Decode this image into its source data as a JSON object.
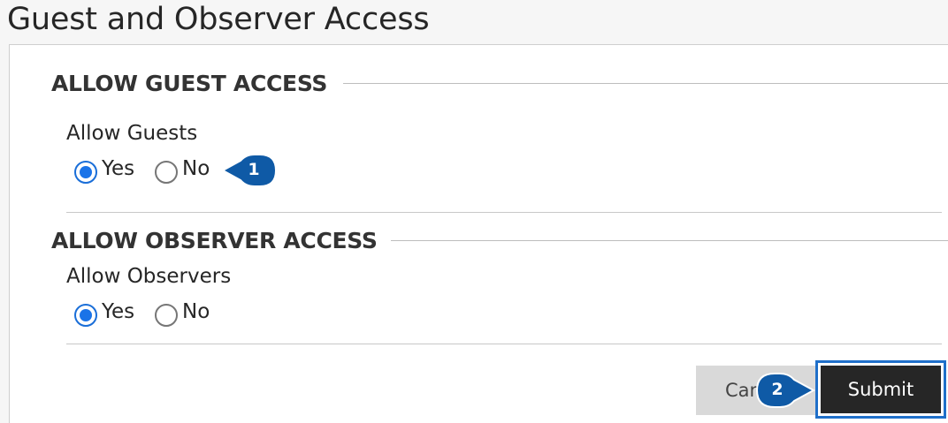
{
  "page": {
    "title": "Guest and Observer Access"
  },
  "guest_section": {
    "heading": "ALLOW GUEST ACCESS",
    "field_label": "Allow Guests",
    "options": [
      {
        "label": "Yes",
        "selected": true
      },
      {
        "label": "No",
        "selected": false
      }
    ]
  },
  "observer_section": {
    "heading": "ALLOW OBSERVER ACCESS",
    "field_label": "Allow Observers",
    "options": [
      {
        "label": "Yes",
        "selected": true
      },
      {
        "label": "No",
        "selected": false
      }
    ]
  },
  "actions": {
    "cancel_label": "Can",
    "submit_label": "Submit"
  },
  "callouts": [
    {
      "number": "1"
    },
    {
      "number": "2"
    }
  ],
  "colors": {
    "accent_blue": "#1a73e8",
    "callout_blue": "#0f5aa6",
    "submit_bg": "#262626"
  }
}
